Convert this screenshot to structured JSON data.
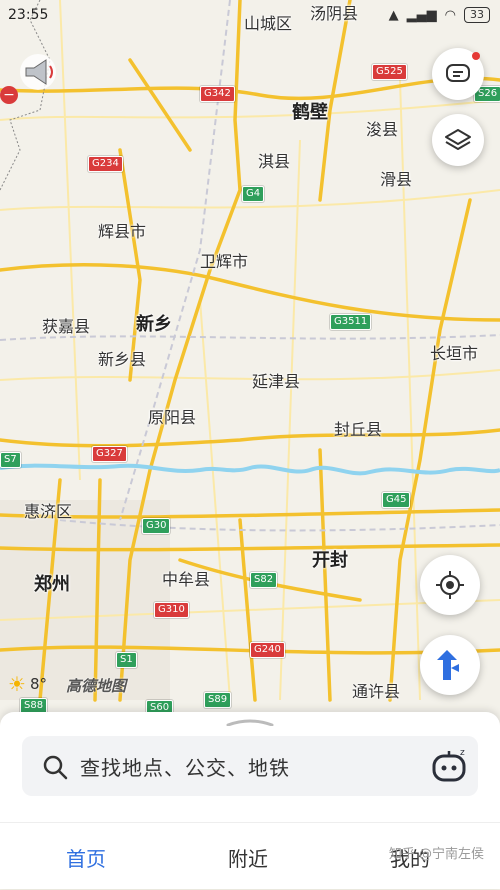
{
  "status_bar": {
    "time": "23:55",
    "battery": "33"
  },
  "map": {
    "river_color": "#8fd3ef",
    "road_color": "#f3c12e",
    "cities": [
      {
        "id": "shancheng",
        "name": "山城区",
        "big": false
      },
      {
        "id": "tangyin",
        "name": "汤阴县",
        "big": false
      },
      {
        "id": "hebi",
        "name": "鹤壁",
        "big": true
      },
      {
        "id": "xunxian",
        "name": "浚县",
        "big": false
      },
      {
        "id": "qixian",
        "name": "淇县",
        "big": false
      },
      {
        "id": "huaxian",
        "name": "滑县",
        "big": false
      },
      {
        "id": "huixian",
        "name": "辉县市",
        "big": false
      },
      {
        "id": "weihui",
        "name": "卫辉市",
        "big": false
      },
      {
        "id": "huojia",
        "name": "获嘉县",
        "big": false
      },
      {
        "id": "xinxiang",
        "name": "新乡",
        "big": true
      },
      {
        "id": "xinxiangxian",
        "name": "新乡县",
        "big": false
      },
      {
        "id": "yanjin",
        "name": "延津县",
        "big": false
      },
      {
        "id": "changyuan",
        "name": "长垣市",
        "big": false
      },
      {
        "id": "yuanyang",
        "name": "原阳县",
        "big": false
      },
      {
        "id": "fengqiu",
        "name": "封丘县",
        "big": false
      },
      {
        "id": "huiji",
        "name": "惠济区",
        "big": false
      },
      {
        "id": "kaifeng",
        "name": "开封",
        "big": true
      },
      {
        "id": "zhengzhou",
        "name": "郑州",
        "big": true
      },
      {
        "id": "zhongmou",
        "name": "中牟县",
        "big": false
      },
      {
        "id": "tongxu",
        "name": "通许县",
        "big": false
      }
    ],
    "shields": [
      {
        "label": "G525",
        "color": "red"
      },
      {
        "label": "G342",
        "color": "red"
      },
      {
        "label": "S26",
        "color": "green"
      },
      {
        "label": "G234",
        "color": "red"
      },
      {
        "label": "G4",
        "color": "green"
      },
      {
        "label": "G3511",
        "color": "green"
      },
      {
        "label": "G327",
        "color": "red"
      },
      {
        "label": "S7",
        "color": "green"
      },
      {
        "label": "G45",
        "color": "green"
      },
      {
        "label": "G30",
        "color": "green"
      },
      {
        "label": "S82",
        "color": "green"
      },
      {
        "label": "G310",
        "color": "red"
      },
      {
        "label": "G240",
        "color": "red"
      },
      {
        "label": "S1",
        "color": "green"
      },
      {
        "label": "S88",
        "color": "green"
      },
      {
        "label": "S60",
        "color": "green"
      },
      {
        "label": "S89",
        "color": "green"
      }
    ],
    "weather_temp": "8°",
    "brand_logo": "高德地图"
  },
  "search": {
    "placeholder": "查找地点、公交、地铁"
  },
  "tabs": [
    {
      "label": "首页",
      "active": true
    },
    {
      "label": "附近",
      "active": false
    },
    {
      "label": "我的",
      "active": false
    }
  ],
  "watermark": "知乎 @宁南左侯",
  "accent": "#2f6fe0"
}
